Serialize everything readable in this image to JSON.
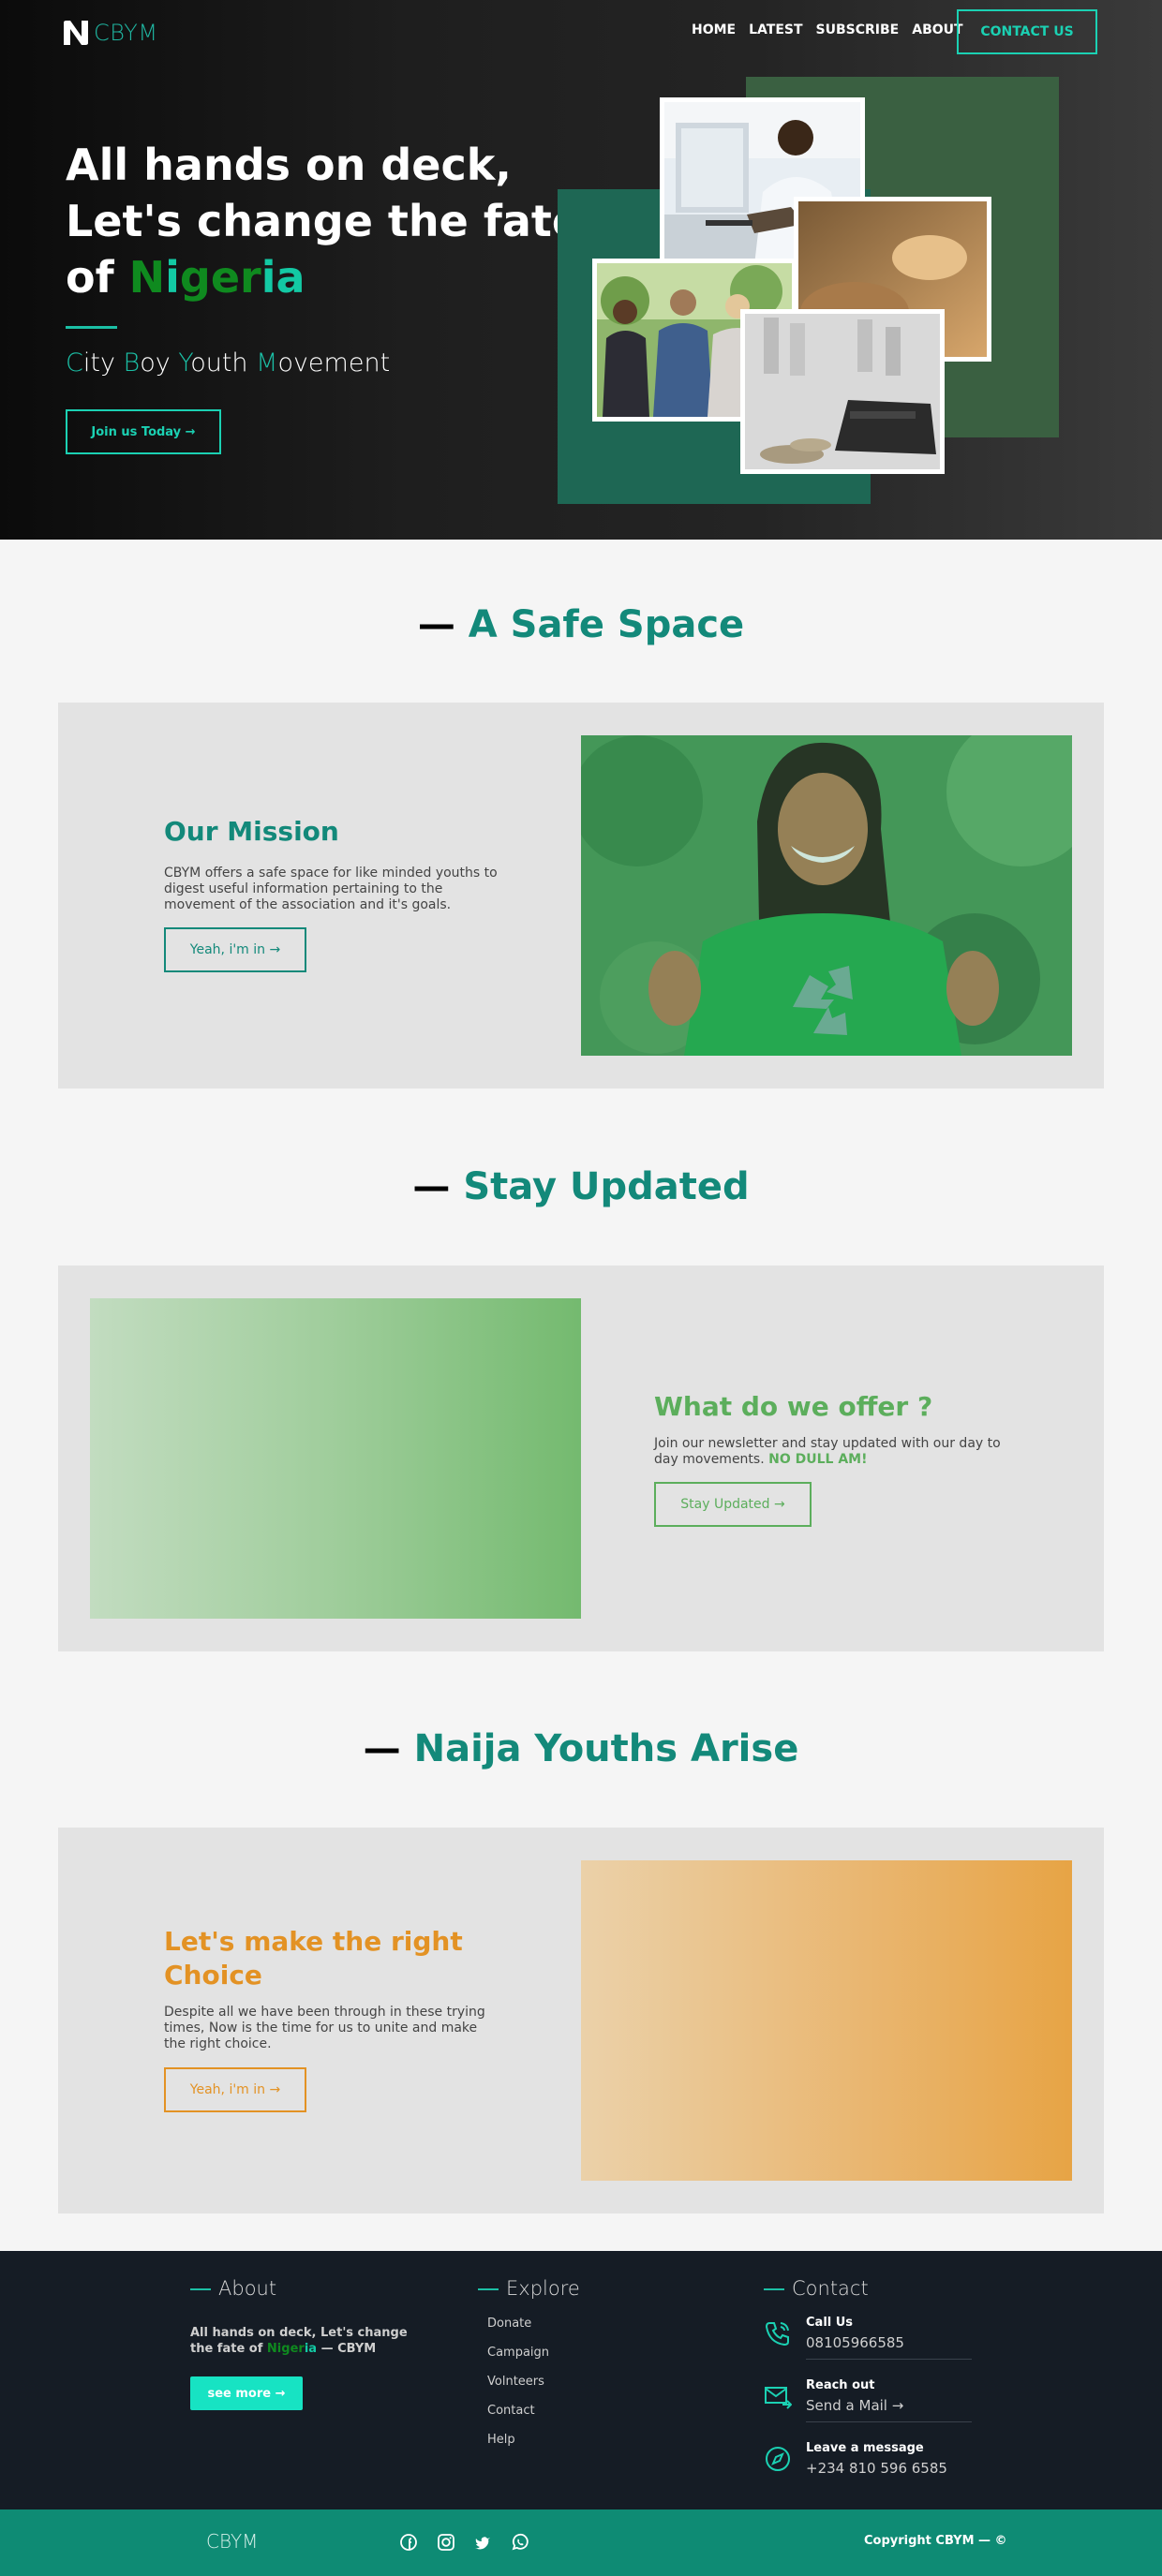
{
  "brand": {
    "logo_text": "CBYM"
  },
  "nav": {
    "items": [
      "HOME",
      "LATEST",
      "SUBSCRIBE",
      "ABOUT"
    ],
    "contact": "CONTACT US"
  },
  "hero": {
    "title_line1": "All hands on deck,",
    "title_line2": "Let's change the fate",
    "title_of": "of ",
    "title_n": "N",
    "title_i": "i",
    "title_ger": "ger",
    "title_ia": "ia",
    "subtitle": [
      {
        "accent": "C",
        "rest": "ity "
      },
      {
        "accent": "B",
        "rest": "oy "
      },
      {
        "accent": "Y",
        "rest": "outh "
      },
      {
        "accent": "M",
        "rest": "ovement"
      }
    ],
    "cta": "Join us Today →"
  },
  "sections": {
    "safe_space": {
      "heading": "A Safe Space",
      "card_title": "Our Mission",
      "card_text": "CBYM offers a safe space for like minded youths to digest useful information pertaining to the movement of the association and it's goals.",
      "button": "Yeah, i'm in →"
    },
    "stay_updated": {
      "heading": "Stay Updated",
      "card_title": "What do we offer ?",
      "card_text": "Join our newsletter and stay updated with our day to day movements. ",
      "card_highlight": "NO DULL AM!",
      "button": "Stay Updated →"
    },
    "naija": {
      "heading": "Naija Youths Arise",
      "card_title": "Let's make the right Choice",
      "card_text": "Despite all we have been through in these trying times, Now is the time for us to unite and make the right choice.",
      "button": "Yeah, i'm in →"
    }
  },
  "footer": {
    "about": {
      "heading": "About",
      "text_a": "All hands on deck, Let's change the fate of ",
      "text_n": "Ni",
      "text_ger": "ger",
      "text_ia": "ia",
      "text_b": " — CBYM",
      "button": "see more →"
    },
    "explore": {
      "heading": "Explore",
      "links": [
        "Donate",
        "Campaign",
        "Volnteers",
        "Contact",
        "Help"
      ]
    },
    "contact": {
      "heading": "Contact",
      "items": [
        {
          "label": "Call Us",
          "value": "08105966585",
          "icon": "phone-icon"
        },
        {
          "label": "Reach out",
          "value": "Send a Mail →",
          "icon": "mail-icon"
        },
        {
          "label": "Leave a message",
          "value": "+234 810 596 6585",
          "icon": "compass-icon"
        }
      ]
    }
  },
  "bottom_bar": {
    "brand": "CBYM",
    "social": [
      "facebook-icon",
      "instagram-icon",
      "twitter-icon",
      "whatsapp-icon"
    ],
    "copyright": "Copyright CBYM — ©"
  },
  "colors": {
    "teal": "#13897a",
    "accent": "#1bd1b3",
    "green": "#5cae5c",
    "orange": "#e39224",
    "footer": "#151c25",
    "bottom_bar": "#0e8b74"
  }
}
